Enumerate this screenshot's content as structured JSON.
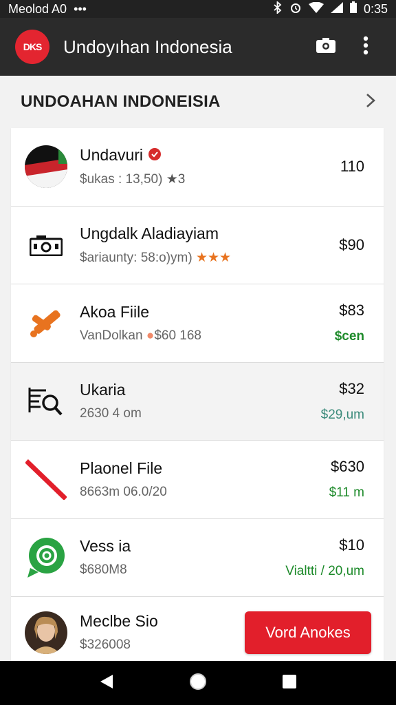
{
  "status_bar": {
    "left_text": "Meolod A0",
    "dots": "•••",
    "time": "0:35"
  },
  "app_bar": {
    "logo_text": "DKS",
    "title": "Undoyıhan Indonesia"
  },
  "section": {
    "title": "UNDOAHAN INDONEISIA"
  },
  "items": [
    {
      "name": "Undavuri",
      "sub": "$ukas : 13,50)",
      "value": "110",
      "sub_right": ""
    },
    {
      "name": "Ungdalk Aladiayiam",
      "sub": "$ariaunty: 58:o)ym)",
      "value": "$90",
      "sub_right": ""
    },
    {
      "name": "Akoa Fiile",
      "sub": "VanDolkan",
      "sub_extra": "$60 168",
      "value": "$83",
      "sub_right": "$cen"
    },
    {
      "name": "Ukaria",
      "sub": "2630 4 om",
      "value": "$32",
      "sub_right": "$29,um"
    },
    {
      "name": "Plaonel File",
      "sub": "8663m 06.0/20",
      "value": "$630",
      "sub_right": "$11 m"
    },
    {
      "name": "Vess ia",
      "sub": "$680M8",
      "value": "$10",
      "sub_right": "Vialtti / 20,um"
    },
    {
      "name": "Meclbe Sio",
      "sub": "$326008",
      "value": "",
      "sub_right": ""
    }
  ],
  "cta": {
    "label": "Vord Anokes"
  },
  "icons": {
    "bluetooth": "bluetooth-icon",
    "alarm": "alarm-icon",
    "wifi": "wifi-icon",
    "signal": "signal-icon",
    "battery": "battery-icon",
    "camera": "camera-icon",
    "more": "more-vert-icon",
    "back": "back-icon",
    "home": "home-icon",
    "recents": "recents-icon"
  },
  "colors": {
    "accent": "#e21f2b",
    "appbar": "#2b2b2b",
    "positive": "#1d8a2a"
  }
}
